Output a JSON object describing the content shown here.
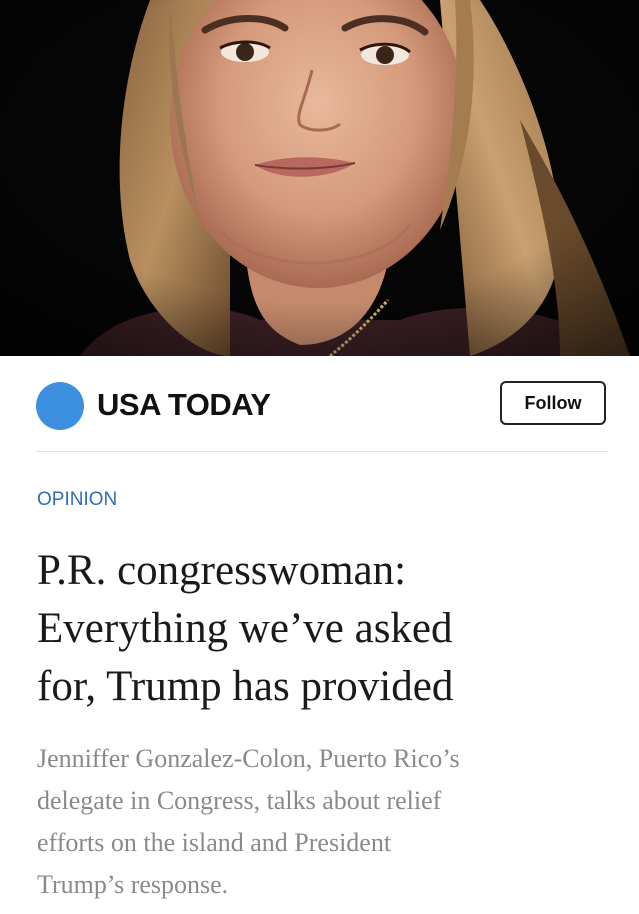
{
  "publisher": {
    "name": "USA TODAY",
    "follow_label": "Follow",
    "logo_color": "#3d8fe0"
  },
  "article": {
    "section": "OPINION",
    "headline_lines": [
      "P.R. congresswoman:",
      "Everything we’ve asked",
      "for, Trump has provided"
    ],
    "summary_lines": [
      "Jenniffer Gonzalez-Colon, Puerto Rico’s",
      "delegate in Congress, talks about relief",
      "efforts on the island and President",
      "Trump’s response."
    ]
  },
  "colors": {
    "section_label": "#2f6db5",
    "headline": "#1a1a1a",
    "summary": "#8a8a8a",
    "photo_background": "#050505"
  }
}
